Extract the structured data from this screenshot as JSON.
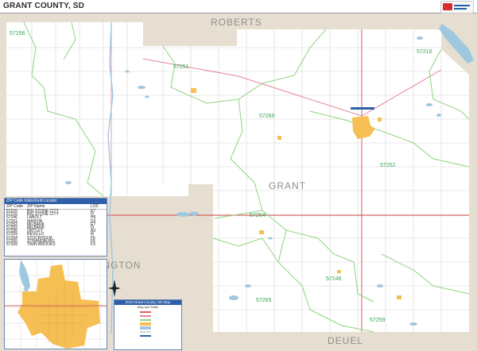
{
  "header": {
    "title": "GRANT COUNTY, SD"
  },
  "map": {
    "county_labels": {
      "roberts": "ROBERTS",
      "grant": "GRANT",
      "codington": "INGTON",
      "deuel": "DEUEL"
    },
    "zip_labels": {
      "z57256": "57256",
      "z57251": "57251",
      "z57269": "57269",
      "z57216": "57216",
      "z57252": "57252",
      "z57264": "57264",
      "z57246": "57246",
      "z57265": "57265",
      "z57259": "57259"
    },
    "colors": {
      "land": "#ffffff",
      "outside_county": "#e6dfd1",
      "water": "#9fc7de",
      "city": "#f5bf53",
      "zip_border": "#8fd47f",
      "highway": "#e3879a",
      "us_route": "#d65f5f",
      "grid": "#d6d6d6",
      "legend_header": "#2f5fa8"
    }
  },
  "legend": {
    "title": "ZIP Code Index/Grid Locator",
    "columns": [
      "ZIP Code",
      "ZIP Name",
      "LOC"
    ],
    "rows": [
      {
        "zip": "57216",
        "name": "BIG STONE CITY",
        "loc": "E7"
      },
      {
        "zip": "57216",
        "name": "BIG STONE CITY",
        "loc": "I2"
      },
      {
        "zip": "57246",
        "name": "LABOLT",
        "loc": "H6"
      },
      {
        "zip": "57251",
        "name": "MARVIN",
        "loc": "D2"
      },
      {
        "zip": "57252",
        "name": "MILBANK",
        "loc": "E7"
      },
      {
        "zip": "57252",
        "name": "MILBANK",
        "loc": "I3"
      },
      {
        "zip": "57256",
        "name": "ORTLEY",
        "loc": "A3"
      },
      {
        "zip": "57259",
        "name": "REVILLO",
        "loc": "I6"
      },
      {
        "zip": "57264",
        "name": "STOCKHOLM",
        "loc": "F5"
      },
      {
        "zip": "57265",
        "name": "STRANDBURG",
        "loc": "F6"
      },
      {
        "zip": "57269",
        "name": "TWIN BROOKS",
        "loc": "F3"
      }
    ]
  },
  "info_box": {
    "title": "2016 Grant County, SD Map",
    "subtitle": "Map and Table"
  }
}
